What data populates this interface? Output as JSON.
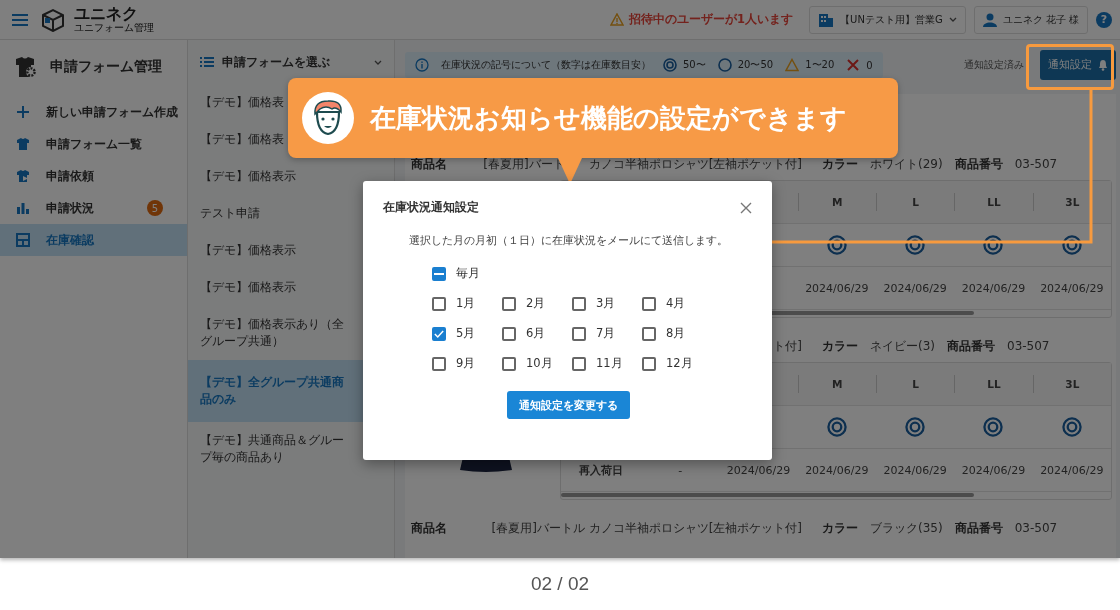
{
  "header": {
    "logo_title": "ユニネク",
    "logo_subtitle": "ユニフォーム管理",
    "alert": "招待中のユーザーが1人います",
    "group": "【UNテスト用】営業G",
    "user": "ユニネク 花子 様",
    "help": "?"
  },
  "sidebar": {
    "title": "申請フォーム管理",
    "items": [
      {
        "label": "新しい申請フォーム作成",
        "selected": false
      },
      {
        "label": "申請フォーム一覧",
        "selected": false
      },
      {
        "label": "申請依頼",
        "selected": false
      },
      {
        "label": "申請状況",
        "selected": false,
        "badge": "5"
      },
      {
        "label": "在庫確認",
        "selected": true
      }
    ]
  },
  "form_picker": {
    "title": "申請フォームを選ぶ",
    "items": [
      {
        "label": "【デモ】価格表",
        "selected": false
      },
      {
        "label": "【デモ】価格表",
        "selected": false
      },
      {
        "label": "【デモ】価格表示",
        "selected": false
      },
      {
        "label": "テスト申請",
        "selected": false
      },
      {
        "label": "【デモ】価格表示",
        "selected": false
      },
      {
        "label": "【デモ】価格表示",
        "selected": false
      },
      {
        "label": "【デモ】価格表示あり（全グループ共通）",
        "selected": false
      },
      {
        "label": "【デモ】全グループ共通商品のみ",
        "selected": true
      },
      {
        "label": "【デモ】共通商品＆グループ毎の商品あり",
        "selected": false
      }
    ]
  },
  "legend": {
    "title": "在庫状況の記号について（数字は在庫数目安）",
    "items": [
      {
        "kind": "plenty",
        "label": "50〜"
      },
      {
        "kind": "some",
        "label": "20〜50"
      },
      {
        "kind": "few",
        "label": "1〜20"
      },
      {
        "kind": "none",
        "label": "0"
      }
    ]
  },
  "notify_status": "通知設定済み",
  "notify_button": "通知設定",
  "products": [
    {
      "name_label": "商品名",
      "name": [
        "[春夏用]バート",
        "カノコ半袖ポロシャツ[左袖ポケット付]"
      ],
      "color_label": "カラー",
      "color_name": "ホワイト(29)",
      "number_label": "商品番号",
      "number": "03-507",
      "table": {
        "columns": [
          {
            "size": "M",
            "kind": "plenty",
            "restock": "2024/06/29"
          },
          {
            "size": "L",
            "kind": "plenty",
            "restock": "2024/06/29"
          },
          {
            "size": "LL",
            "kind": "plenty",
            "restock": "2024/06/29"
          },
          {
            "size": "3L",
            "kind": "plenty",
            "restock": "2024/06/29"
          }
        ]
      }
    },
    {
      "name": [
        "ト付]"
      ],
      "color_label": "カラー",
      "color_name": "ネイビー(3)",
      "number_label": "商品番号",
      "number": "03-507",
      "photo": true,
      "table": {
        "restock_label": "再入荷日",
        "columns": [
          {
            "restock": "-"
          },
          {
            "restock": "2024/06/29"
          },
          {
            "size": "M",
            "kind": "plenty",
            "restock": "2024/06/29"
          },
          {
            "size": "L",
            "kind": "plenty",
            "restock": "2024/06/29"
          },
          {
            "size": "LL",
            "kind": "plenty",
            "restock": "2024/06/29"
          },
          {
            "size": "3L",
            "kind": "plenty",
            "restock": "2024/06/29"
          }
        ]
      }
    },
    {
      "name_label": "商品名",
      "name": [
        "[春夏用]バートル カノコ半袖ポロシャツ[左袖ポケット付]"
      ],
      "color_label": "カラー",
      "color_name": "ブラック(35)",
      "number_label": "商品番号",
      "number": "03-507"
    }
  ],
  "modal": {
    "title": "在庫状況通知設定",
    "description": "選択した月の月初（１日）に在庫状況をメールにて送信します。",
    "all": {
      "label": "毎月",
      "checked": false,
      "indeterminate": true
    },
    "months": [
      {
        "label": "1月",
        "checked": false
      },
      {
        "label": "2月",
        "checked": false
      },
      {
        "label": "3月",
        "checked": false
      },
      {
        "label": "4月",
        "checked": false
      },
      {
        "label": "5月",
        "checked": true
      },
      {
        "label": "6月",
        "checked": false
      },
      {
        "label": "7月",
        "checked": false
      },
      {
        "label": "8月",
        "checked": false
      },
      {
        "label": "9月",
        "checked": false
      },
      {
        "label": "10月",
        "checked": false
      },
      {
        "label": "11月",
        "checked": false
      },
      {
        "label": "12月",
        "checked": false
      }
    ],
    "submit": "通知設定を変更する"
  },
  "callout": {
    "text": "在庫状況お知らせ機能の設定ができます"
  },
  "pager": "02 / 02"
}
